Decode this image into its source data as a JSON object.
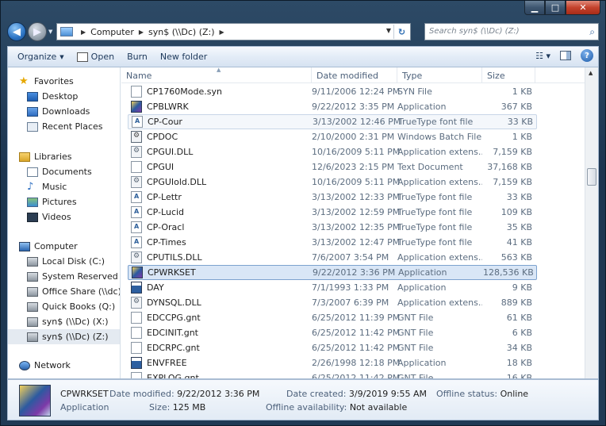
{
  "address": {
    "crumbs": [
      "Computer",
      "syn$ (\\\\Dc) (Z:)"
    ],
    "search_placeholder": "Search syn$ (\\\\Dc) (Z:)"
  },
  "toolbar": {
    "organize": "Organize",
    "open": "Open",
    "burn": "Burn",
    "new_folder": "New folder"
  },
  "nav": {
    "favorites": "Favorites",
    "desktop": "Desktop",
    "downloads": "Downloads",
    "recent": "Recent Places",
    "libraries": "Libraries",
    "documents": "Documents",
    "music": "Music",
    "pictures": "Pictures",
    "videos": "Videos",
    "computer": "Computer",
    "drives": [
      "Local Disk (C:)",
      "System Reserved (F:)",
      "Office Share (\\\\dc) (",
      "Quick Books (Q:)",
      "syn$ (\\\\Dc) (X:)",
      "syn$ (\\\\Dc) (Z:)"
    ],
    "network": "Network"
  },
  "columns": {
    "name": "Name",
    "date": "Date modified",
    "type": "Type",
    "size": "Size"
  },
  "files": [
    {
      "name": "CP1760Mode.syn",
      "date": "9/11/2006 12:24 PM",
      "type": "SYN File",
      "size": "1 KB",
      "icon": "gen"
    },
    {
      "name": "CPBLWRK",
      "date": "9/22/2012 3:35 PM",
      "type": "Application",
      "size": "367 KB",
      "icon": "app"
    },
    {
      "name": "CP-Cour",
      "date": "3/13/2002 12:46 PM",
      "type": "TrueType font file",
      "size": "33 KB",
      "icon": "ttf"
    },
    {
      "name": "CPDOC",
      "date": "2/10/2000 2:31 PM",
      "type": "Windows Batch File",
      "size": "1 KB",
      "icon": "bat"
    },
    {
      "name": "CPGUI.DLL",
      "date": "10/16/2009 5:11 PM",
      "type": "Application extens...",
      "size": "7,159 KB",
      "icon": "dll"
    },
    {
      "name": "CPGUI",
      "date": "12/6/2023 2:15 PM",
      "type": "Text Document",
      "size": "37,168 KB",
      "icon": "txt"
    },
    {
      "name": "CPGUIold.DLL",
      "date": "10/16/2009 5:11 PM",
      "type": "Application extens...",
      "size": "7,159 KB",
      "icon": "dll"
    },
    {
      "name": "CP-Lettr",
      "date": "3/13/2002 12:33 PM",
      "type": "TrueType font file",
      "size": "33 KB",
      "icon": "ttf"
    },
    {
      "name": "CP-Lucid",
      "date": "3/13/2002 12:59 PM",
      "type": "TrueType font file",
      "size": "109 KB",
      "icon": "ttf"
    },
    {
      "name": "CP-Oracl",
      "date": "3/13/2002 12:35 PM",
      "type": "TrueType font file",
      "size": "35 KB",
      "icon": "ttf"
    },
    {
      "name": "CP-Times",
      "date": "3/13/2002 12:47 PM",
      "type": "TrueType font file",
      "size": "41 KB",
      "icon": "ttf"
    },
    {
      "name": "CPUTILS.DLL",
      "date": "7/6/2007 3:54 PM",
      "type": "Application extens...",
      "size": "563 KB",
      "icon": "dll"
    },
    {
      "name": "CPWRKSET",
      "date": "9/22/2012 3:36 PM",
      "type": "Application",
      "size": "128,536 KB",
      "icon": "app"
    },
    {
      "name": "DAY",
      "date": "7/1/1993 1:33 PM",
      "type": "Application",
      "size": "9 KB",
      "icon": "appwin"
    },
    {
      "name": "DYNSQL.DLL",
      "date": "7/3/2007 6:39 PM",
      "type": "Application extens...",
      "size": "889 KB",
      "icon": "dll"
    },
    {
      "name": "EDCCPG.gnt",
      "date": "6/25/2012 11:39 PM",
      "type": "GNT File",
      "size": "61 KB",
      "icon": "gen"
    },
    {
      "name": "EDCINIT.gnt",
      "date": "6/25/2012 11:42 PM",
      "type": "GNT File",
      "size": "6 KB",
      "icon": "gen"
    },
    {
      "name": "EDCRPC.gnt",
      "date": "6/25/2012 11:42 PM",
      "type": "GNT File",
      "size": "34 KB",
      "icon": "gen"
    },
    {
      "name": "ENVFREE",
      "date": "2/26/1998 12:18 PM",
      "type": "Application",
      "size": "18 KB",
      "icon": "appwin"
    },
    {
      "name": "EXPLOG.gnt",
      "date": "6/25/2012 11:42 PM",
      "type": "GNT File",
      "size": "16 KB",
      "icon": "gen"
    }
  ],
  "details": {
    "name": "CPWRKSET",
    "type": "Application",
    "date_modified_label": "Date modified:",
    "date_modified": "9/22/2012 3:36 PM",
    "size_label": "Size:",
    "size": "125 MB",
    "date_created_label": "Date created:",
    "date_created": "3/9/2019 9:55 AM",
    "offline_avail_label": "Offline availability:",
    "offline_avail": "Not available",
    "offline_status_label": "Offline status:",
    "offline_status": "Online"
  }
}
